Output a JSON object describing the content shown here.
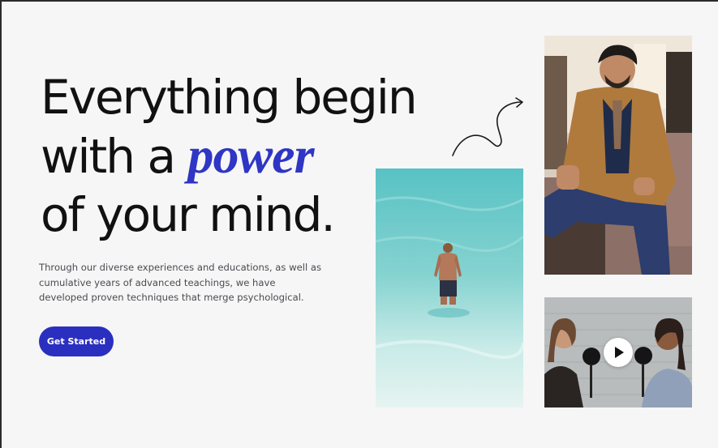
{
  "hero": {
    "headline": {
      "line1": "Everything begin",
      "line2_prefix": "with a ",
      "line2_accent": "power",
      "line3": "of your mind."
    },
    "description": "Through our diverse experiences and educations, as well as cumulative years of advanced teachings, we have developed proven techniques that merge psychological.",
    "cta_label": "Get Started"
  },
  "media": {
    "icons": [
      "curly-arrow-icon",
      "play-icon"
    ]
  },
  "colors": {
    "accent": "#2f35c4",
    "button": "#2b2fbf",
    "background": "#f6f6f7",
    "text": "#111111"
  }
}
